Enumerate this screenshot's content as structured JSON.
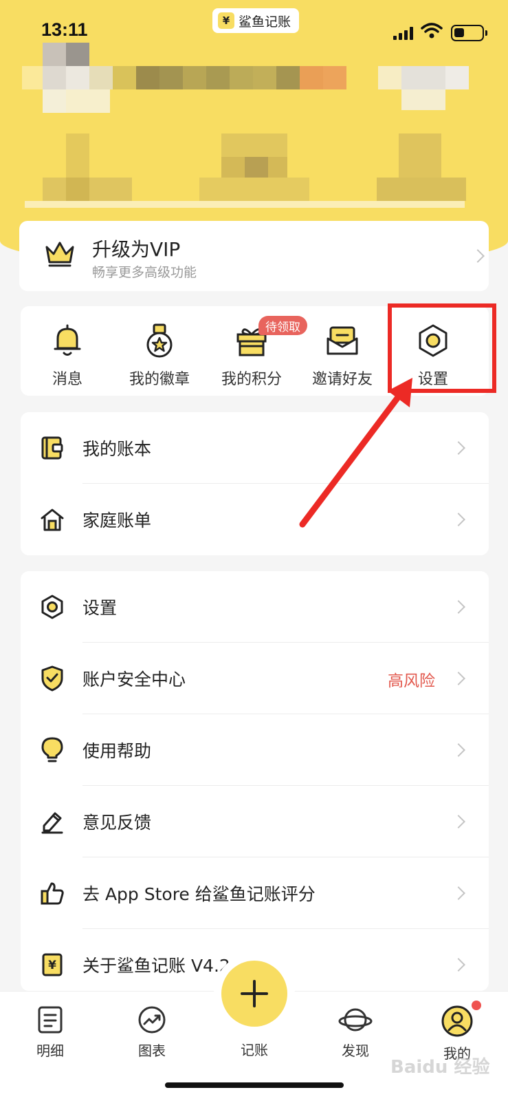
{
  "status_bar": {
    "time": "13:11",
    "app_name": "鲨鱼记账",
    "app_icon": "yen-icon"
  },
  "vip": {
    "title": "升级为VIP",
    "subtitle": "畅享更多高级功能"
  },
  "quick_actions": [
    {
      "label": "消息",
      "icon": "bell-icon"
    },
    {
      "label": "我的徽章",
      "icon": "medal-icon"
    },
    {
      "label": "我的积分",
      "icon": "gift-icon",
      "badge": "待领取"
    },
    {
      "label": "邀请好友",
      "icon": "envelope-icon"
    },
    {
      "label": "设置",
      "icon": "settings-hex-icon"
    }
  ],
  "list_group_1": [
    {
      "label": "我的账本",
      "icon": "wallet-icon"
    },
    {
      "label": "家庭账单",
      "icon": "home-icon"
    }
  ],
  "list_group_2": [
    {
      "label": "设置",
      "icon": "settings-hex-icon"
    },
    {
      "label": "账户安全中心",
      "icon": "shield-check-icon",
      "status": "高风险"
    },
    {
      "label": "使用帮助",
      "icon": "lightbulb-icon"
    },
    {
      "label": "意见反馈",
      "icon": "edit-icon"
    },
    {
      "label": "去 App Store 给鲨鱼记账评分",
      "icon": "thumbs-up-icon"
    },
    {
      "label": "关于鲨鱼记账 V4.2",
      "icon": "yen-icon"
    }
  ],
  "tabbar": [
    {
      "label": "明细",
      "icon": "document-icon"
    },
    {
      "label": "图表",
      "icon": "chart-trend-icon"
    },
    {
      "label": "记账",
      "icon": "plus-icon"
    },
    {
      "label": "发现",
      "icon": "planet-icon"
    },
    {
      "label": "我的",
      "icon": "user-icon"
    }
  ],
  "colors": {
    "brand": "#f8dd62",
    "highlight": "#ec2a25",
    "risk": "#e2574c",
    "badge": "#e8645d"
  },
  "watermark": "Baidu 经验"
}
